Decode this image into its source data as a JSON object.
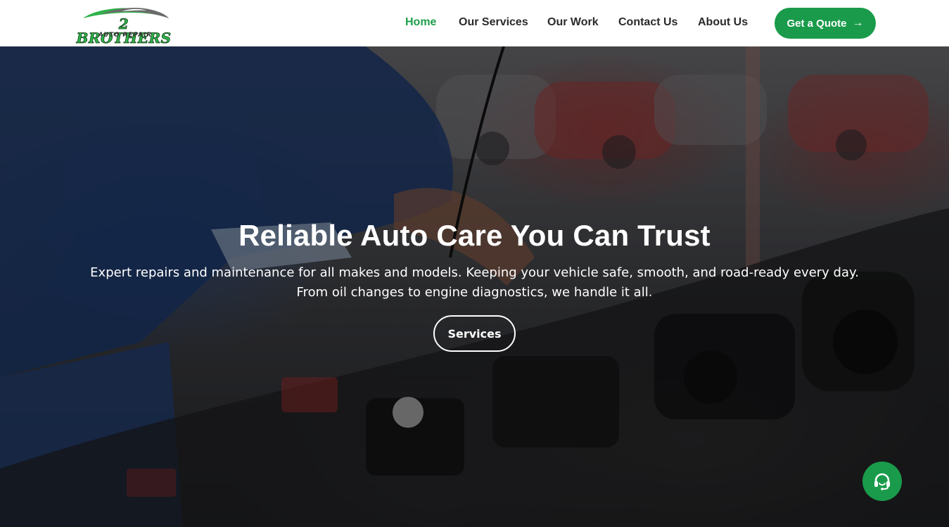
{
  "brand": {
    "name_line1": "2 BROTHERS",
    "name_line2": "AUTO REPAIR",
    "green": "#1a9b4b"
  },
  "nav": {
    "items": [
      {
        "label": "Home",
        "active": true
      },
      {
        "label": "Our Services",
        "active": false
      },
      {
        "label": "Our Work",
        "active": false
      },
      {
        "label": "Contact Us",
        "active": false
      },
      {
        "label": "About Us",
        "active": false
      }
    ],
    "cta_label": "Get a Quote",
    "cta_icon": "arrow-right-icon"
  },
  "hero": {
    "title": "Reliable Auto Care You Can Trust",
    "subtitle": "Expert repairs and maintenance for all makes and models. Keeping your vehicle safe, smooth, and road-ready every day. From oil changes to engine diagnostics, we handle it all.",
    "button_label": "Services"
  },
  "support": {
    "icon": "headset-icon"
  }
}
